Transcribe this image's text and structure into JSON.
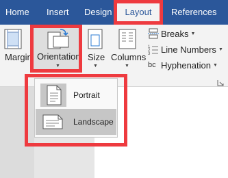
{
  "tabs": [
    {
      "label": "Home"
    },
    {
      "label": "Insert"
    },
    {
      "label": "Design"
    },
    {
      "label": "Layout",
      "active": true
    },
    {
      "label": "References"
    }
  ],
  "ribbon": {
    "margins_label": "Margins",
    "orientation_label": "Orientation",
    "size_label": "Size",
    "columns_label": "Columns",
    "breaks_label": "Breaks",
    "line_numbers_label": "Line Numbers",
    "hyphenation_label": "Hyphenation",
    "hyphenation_icon_text": "bc"
  },
  "orientation_menu": {
    "items": [
      {
        "label": "Portrait",
        "icon": "portrait-page-icon"
      },
      {
        "label": "Landscape",
        "icon": "landscape-page-icon",
        "hovered": true
      }
    ]
  },
  "colors": {
    "ribbon_blue": "#2b579a",
    "highlight_red": "#ee3a3f",
    "ribbon_bg": "#f3f3f3"
  }
}
